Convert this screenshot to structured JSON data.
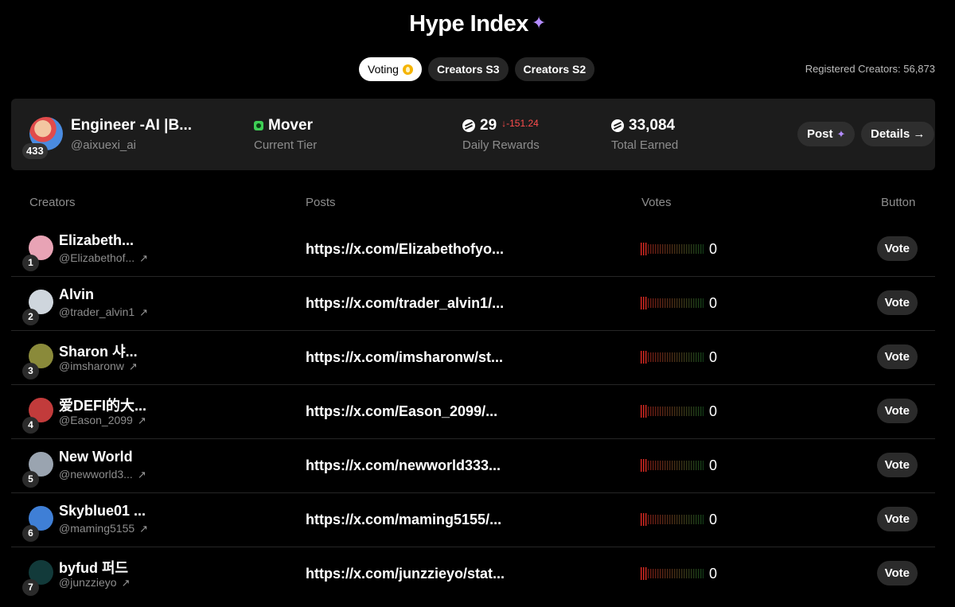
{
  "header": {
    "title": "Hype Index",
    "registered": "Registered Creators: 56,873"
  },
  "tabs": [
    {
      "label": "Voting",
      "active": true
    },
    {
      "label": "Creators S3",
      "active": false
    },
    {
      "label": "Creators S2",
      "active": false
    }
  ],
  "profile": {
    "name": "Engineer -AI |B...",
    "handle": "@aixuexi_ai",
    "rank": "433",
    "tier": "Mover",
    "tier_label": "Current Tier",
    "daily_rewards": "29",
    "daily_delta": "↓-151.24",
    "daily_label": "Daily Rewards",
    "total_earned": "33,084",
    "total_label": "Total Earned",
    "post_label": "Post",
    "details_label": "Details →"
  },
  "table": {
    "columns": [
      "Creators",
      "Posts",
      "Votes",
      "Button"
    ],
    "rows": [
      {
        "rank": "1",
        "name": "Elizabeth...",
        "handle": "@Elizabethof...",
        "post": "https://x.com/Elizabethofyo...",
        "votes": "0",
        "button": "Vote",
        "avatar_color": "#e8a3b5"
      },
      {
        "rank": "2",
        "name": "Alvin",
        "handle": "@trader_alvin1",
        "post": "https://x.com/trader_alvin1/...",
        "votes": "0",
        "button": "Vote",
        "avatar_color": "#cfd6dd"
      },
      {
        "rank": "3",
        "name": "Sharon 샤...",
        "handle": "@imsharonw",
        "post": "https://x.com/imsharonw/st...",
        "votes": "0",
        "button": "Vote",
        "avatar_color": "#8a8a3a"
      },
      {
        "rank": "4",
        "name": "爱DEFI的大...",
        "handle": "@Eason_2099",
        "post": "https://x.com/Eason_2099/...",
        "votes": "0",
        "button": "Vote",
        "avatar_color": "#c23b3b"
      },
      {
        "rank": "5",
        "name": "New World",
        "handle": "@newworld3...",
        "post": "https://x.com/newworld333...",
        "votes": "0",
        "button": "Vote",
        "avatar_color": "#9aa4b0"
      },
      {
        "rank": "6",
        "name": "Skyblue01 ...",
        "handle": "@maming5155",
        "post": "https://x.com/maming5155/...",
        "votes": "0",
        "button": "Vote",
        "avatar_color": "#3f7fd6"
      },
      {
        "rank": "7",
        "name": "byfud 퍼드",
        "handle": "@junzzieyo",
        "post": "https://x.com/junzzieyo/stat...",
        "votes": "0",
        "button": "Vote",
        "avatar_color": "#123a3a"
      }
    ]
  }
}
